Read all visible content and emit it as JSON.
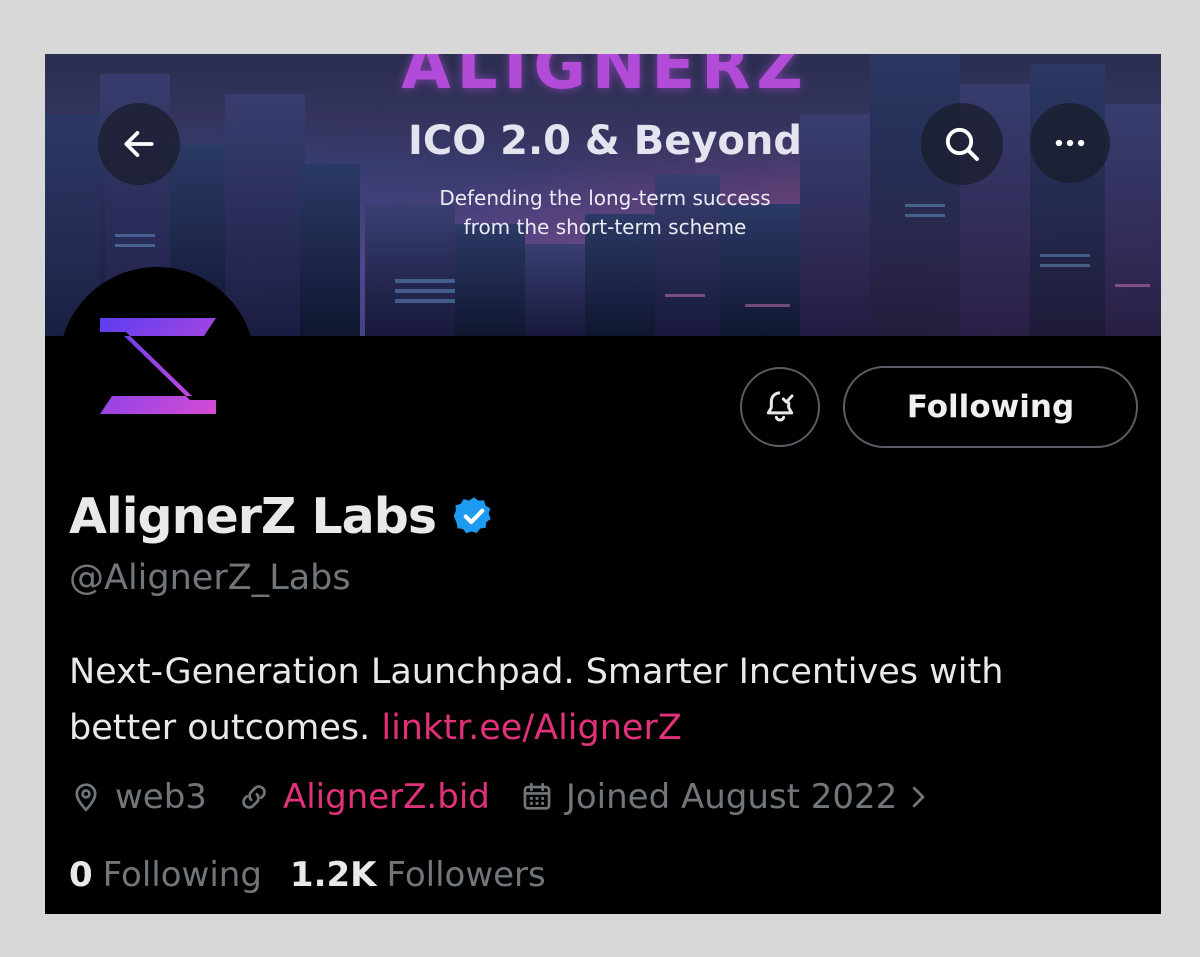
{
  "banner": {
    "logo_text": "ALIGNERZ",
    "title": "ICO 2.0 & Beyond",
    "subtitle_line1": "Defending the long-term success",
    "subtitle_line2": "from the short-term scheme"
  },
  "profile": {
    "display_name": "AlignerZ Labs",
    "handle": "@AlignerZ_Labs",
    "verified": true,
    "bio_text": "Next-Generation Launchpad. Smarter Incentives with better outcomes. ",
    "bio_link": "linktr.ee/AlignerZ",
    "location": "web3",
    "website": "AlignerZ.bid",
    "joined": "Joined August 2022"
  },
  "actions": {
    "follow_label": "Following"
  },
  "stats": {
    "following_count": "0",
    "following_label": "Following",
    "followers_count": "1.2K",
    "followers_label": "Followers"
  },
  "colors": {
    "link": "#e0317a",
    "muted": "#71767b",
    "text": "#e7e9ea",
    "verified": "#1d9bf0",
    "brand_purple": "#7b3fe4"
  },
  "icons": [
    "back-arrow-icon",
    "search-icon",
    "more-icon",
    "bell-check-icon",
    "verified-badge-icon",
    "location-icon",
    "link-icon",
    "calendar-icon",
    "chevron-right-icon"
  ]
}
